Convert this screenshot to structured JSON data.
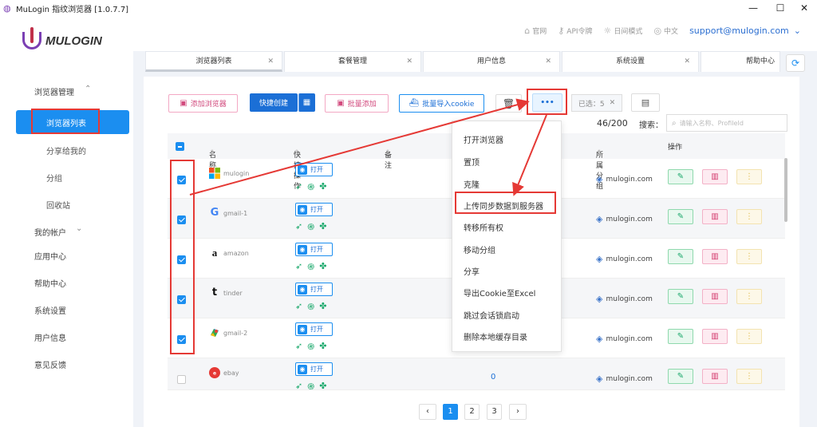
{
  "window": {
    "title": "MuLogin 指纹浏览器 [1.0.7.7]",
    "minimize": "—",
    "maximize": "☐",
    "close": "✕"
  },
  "logo": {
    "text": "MULOGIN"
  },
  "header": {
    "nav": [
      {
        "label": "官网",
        "icon": "home-icon"
      },
      {
        "label": "API令牌",
        "icon": "api-key-icon"
      },
      {
        "label": "日间模式",
        "icon": "sun-icon"
      },
      {
        "label": "中文",
        "icon": "globe-icon"
      }
    ],
    "email": "support@mulogin.com"
  },
  "sidebar": {
    "browser_management": "浏览器管理",
    "browser_list": "浏览器列表",
    "shared_with_me": "分享给我的",
    "groups": "分组",
    "recycle_bin": "回收站",
    "my_account": "我的帐户",
    "app_center": "应用中心",
    "help_center": "帮助中心",
    "system_settings": "系统设置",
    "user_info": "用户信息",
    "feedback": "意见反馈"
  },
  "tabs": [
    {
      "label": "浏览器列表"
    },
    {
      "label": "套餐管理"
    },
    {
      "label": "用户信息"
    },
    {
      "label": "系统设置"
    },
    {
      "label": "帮助中心"
    }
  ],
  "toolbar": {
    "add_browser": "添加浏览器",
    "quick_create": "快捷创建",
    "batch_add": "批量添加",
    "import_cookie": "批量导入cookie",
    "more": "•••",
    "selected": "已选：5",
    "count": "46/200",
    "search_label": "搜索：",
    "search_placeholder": "请输入名称、ProfileId"
  },
  "table": {
    "headers": {
      "name": "名称",
      "quick_ops": "快捷操作",
      "remark": "备注",
      "group": "所属分组",
      "actions": "操作"
    },
    "open_label": "打开",
    "rows": [
      {
        "name": "mulogin",
        "icon": "microsoft-icon",
        "checked": true,
        "group": "mulogin.com"
      },
      {
        "name": "gmail-1",
        "icon": "google-icon",
        "checked": true,
        "group": "mulogin.com"
      },
      {
        "name": "amazon",
        "icon": "amazon-icon",
        "checked": true,
        "group": "mulogin.com"
      },
      {
        "name": "tinder",
        "icon": "tinder-icon",
        "checked": true,
        "group": "mulogin.com"
      },
      {
        "name": "gmail-2",
        "icon": "google-maps-icon",
        "checked": true,
        "group": "mulogin.com"
      },
      {
        "name": "ebay",
        "icon": "ebay-icon",
        "checked": false,
        "group": "mulogin.com",
        "remark_value": "0"
      }
    ]
  },
  "menu": {
    "items": [
      "打开浏览器",
      "置顶",
      "克隆",
      "上传同步数据到服务器",
      "转移所有权",
      "移动分组",
      "分享",
      "导出Cookie至Excel",
      "跳过会话锁启动",
      "删除本地缓存目录"
    ]
  },
  "pagination": {
    "prev": "‹",
    "pages": [
      "1",
      "2",
      "3"
    ],
    "current": "1",
    "next": "›"
  },
  "colors": {
    "accent": "#1b8ef0",
    "annotation": "#e53935"
  }
}
